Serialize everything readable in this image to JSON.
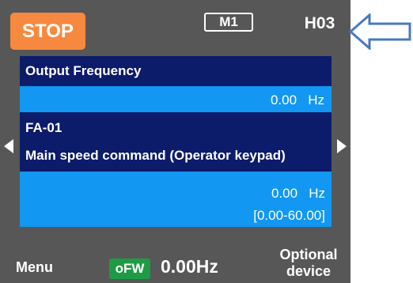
{
  "header": {
    "stop_label": "STOP",
    "motor_badge": "M1",
    "code": "H03"
  },
  "monitor": {
    "title": "Output Frequency",
    "value": "0.00",
    "unit": "Hz"
  },
  "parameter": {
    "code": "FA-01",
    "description": "Main speed command (Operator keypad)",
    "value": "0.00",
    "unit": "Hz",
    "range": "[0.00-60.00]"
  },
  "footer": {
    "menu_label": "Menu",
    "status_badge": "oFW",
    "frequency": "0.00Hz",
    "optional_line1": "Optional",
    "optional_line2": "device"
  },
  "colors": {
    "screen_bg": "#575757",
    "stop_orange": "#f6893f",
    "panel_dark": "#0c1b6a",
    "panel_light": "#1297f3",
    "badge_green": "#1f9b45",
    "arrow_blue": "#4a78bf"
  },
  "icons": [
    "left-arrow-icon",
    "right-arrow-icon",
    "pointer-arrow-icon"
  ]
}
